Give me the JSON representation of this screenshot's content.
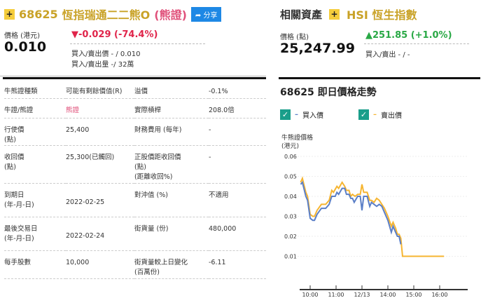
{
  "warrant": {
    "code": "68625",
    "name": "恆指瑞通二二熊O",
    "type_tag": "(熊證)",
    "share_label": "分享",
    "price_label": "價格 (港元)",
    "price": "0.010",
    "change": "▼-0.029 (-74.4%)",
    "bid_ask_price": "買入/賣出價 - / 0.010",
    "bid_ask_volume": "買入/賣出量 -/ 32萬"
  },
  "related": {
    "title": "相關資產",
    "name": "HSI 恆生指數",
    "price_label": "價格 (點)",
    "price": "25,247.99",
    "change": "▲251.85 (+1.0%)",
    "bid_ask": "買入/賣出 - / -"
  },
  "details": [
    {
      "l1": "牛熊證種類",
      "v1": "可能有剩餘價值(R)",
      "l2": "溢價",
      "v2": "-0.1%"
    },
    {
      "l1": "牛證/熊證",
      "v1": "熊證",
      "l2": "實際槓桿",
      "v2": "208.0倍"
    },
    {
      "l1": "行使價\n(點)",
      "v1": "25,400",
      "l2": "財務費用 (每年)",
      "v2": "-"
    },
    {
      "l1": "收回價\n(點)",
      "v1": "25,300(已觸回)",
      "l2": "正股價距收回價\n(點)\n(距離收回%)",
      "v2": "-"
    },
    {
      "l1": "到期日\n(年-月-日)",
      "v1": "2022-02-25",
      "l2": "對沖值 (%)",
      "v2": "不適用"
    },
    {
      "l1": "最後交易日\n(年-月-日)",
      "v1": "2022-02-24",
      "l2": "街貨量 (份)",
      "v2": "480,000"
    },
    {
      "l1": "每手股數",
      "v1": "10,000",
      "l2": "街貨量較上日變化\n(百萬份)",
      "v2": "-6.11"
    }
  ],
  "chart_title": "68625 即日價格走勢",
  "legend": {
    "bid": "買入價",
    "ask": "賣出價"
  },
  "colors": {
    "bid": "#5b7fc7",
    "ask": "#f6b531",
    "gold": "#c9a227"
  },
  "chart_data": {
    "type": "line",
    "ylabel": "牛熊證價格\n(港元)",
    "ylim": [
      0,
      0.06
    ],
    "yticks": [
      "0.01",
      "0.02",
      "0.03",
      "0.04",
      "0.05",
      "0.06"
    ],
    "x_unit": "trading minutes from 09:30 (lunch collapsed)",
    "xticks": [
      {
        "label": "10:00",
        "x": 30
      },
      {
        "label": "11:00",
        "x": 90
      },
      {
        "label": "12/13",
        "x": 150
      },
      {
        "label": "14:00",
        "x": 210
      },
      {
        "label": "15:00",
        "x": 270
      },
      {
        "label": "16:00",
        "x": 330
      }
    ],
    "series": [
      {
        "name": "賣出價",
        "color": "#f6b531",
        "points": [
          [
            8,
            0.047
          ],
          [
            12,
            0.049
          ],
          [
            20,
            0.042
          ],
          [
            24,
            0.04
          ],
          [
            30,
            0.031
          ],
          [
            36,
            0.03
          ],
          [
            40,
            0.03
          ],
          [
            46,
            0.033
          ],
          [
            56,
            0.036
          ],
          [
            66,
            0.036
          ],
          [
            74,
            0.038
          ],
          [
            80,
            0.043
          ],
          [
            84,
            0.042
          ],
          [
            92,
            0.045
          ],
          [
            96,
            0.044
          ],
          [
            104,
            0.047
          ],
          [
            110,
            0.045
          ],
          [
            114,
            0.043
          ],
          [
            120,
            0.043
          ],
          [
            124,
            0.04
          ],
          [
            128,
            0.041
          ],
          [
            134,
            0.04
          ],
          [
            140,
            0.041
          ],
          [
            146,
            0.041
          ],
          [
            150,
            0.046
          ],
          [
            154,
            0.042
          ],
          [
            162,
            0.042
          ],
          [
            168,
            0.038
          ],
          [
            172,
            0.038
          ],
          [
            178,
            0.037
          ],
          [
            184,
            0.039
          ],
          [
            190,
            0.038
          ],
          [
            196,
            0.036
          ],
          [
            202,
            0.034
          ],
          [
            210,
            0.03
          ],
          [
            218,
            0.025
          ],
          [
            222,
            0.027
          ],
          [
            228,
            0.024
          ],
          [
            232,
            0.021
          ],
          [
            236,
            0.021
          ],
          [
            240,
            0.019
          ],
          [
            244,
            0.01
          ],
          [
            340,
            0.01
          ]
        ]
      },
      {
        "name": "買入價",
        "color": "#5b7fc7",
        "points": [
          [
            8,
            0.046
          ],
          [
            12,
            0.047
          ],
          [
            20,
            0.04
          ],
          [
            24,
            0.038
          ],
          [
            30,
            0.029
          ],
          [
            36,
            0.028
          ],
          [
            40,
            0.028
          ],
          [
            46,
            0.031
          ],
          [
            56,
            0.034
          ],
          [
            66,
            0.034
          ],
          [
            74,
            0.036
          ],
          [
            80,
            0.04
          ],
          [
            88,
            0.04
          ],
          [
            92,
            0.042
          ],
          [
            96,
            0.041
          ],
          [
            104,
            0.044
          ],
          [
            110,
            0.044
          ],
          [
            114,
            0.041
          ],
          [
            120,
            0.041
          ],
          [
            124,
            0.039
          ],
          [
            128,
            0.039
          ],
          [
            132,
            0.037
          ],
          [
            140,
            0.04
          ],
          [
            146,
            0.04
          ],
          [
            150,
            0.033
          ],
          [
            154,
            0.04
          ],
          [
            162,
            0.04
          ],
          [
            168,
            0.035
          ],
          [
            172,
            0.037
          ],
          [
            178,
            0.036
          ],
          [
            184,
            0.035
          ],
          [
            190,
            0.036
          ],
          [
            196,
            0.035
          ],
          [
            202,
            0.032
          ],
          [
            210,
            0.028
          ],
          [
            218,
            0.022
          ],
          [
            222,
            0.025
          ],
          [
            228,
            0.022
          ],
          [
            232,
            0.02
          ],
          [
            236,
            0.02
          ],
          [
            240,
            0.016
          ]
        ]
      }
    ]
  }
}
